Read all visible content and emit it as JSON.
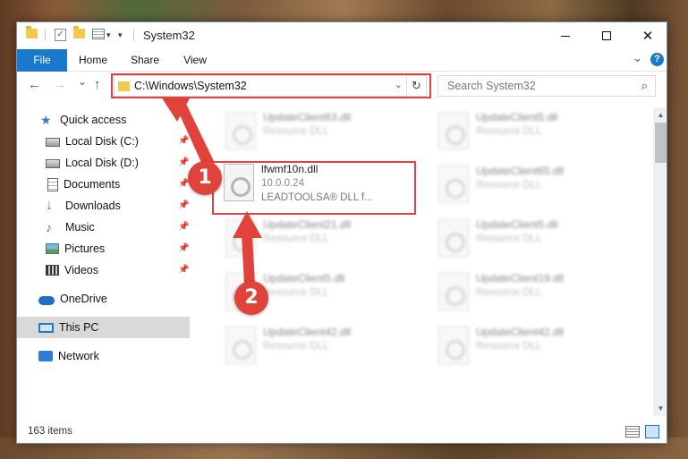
{
  "window": {
    "title": "System32",
    "controls": {
      "minimize": "",
      "maximize": "",
      "close": "✕"
    }
  },
  "ribbon": {
    "tabs": [
      "File",
      "Home",
      "Share",
      "View"
    ],
    "expand_glyph": "⌄",
    "help_glyph": "?"
  },
  "navigation": {
    "back_glyph": "←",
    "forward_glyph": "→",
    "recent_glyph": "⌄",
    "up_glyph": "↑"
  },
  "address": {
    "path": "C:\\Windows\\System32",
    "dropdown_glyph": "⌄",
    "refresh_glyph": "↻"
  },
  "search": {
    "placeholder": "Search System32",
    "icon_glyph": "⌕"
  },
  "sidebar": {
    "items": [
      {
        "label": "Quick access",
        "icon": "star-icon",
        "pinned": false
      },
      {
        "label": "Local Disk (C:)",
        "icon": "drive-icon",
        "pinned": true
      },
      {
        "label": "Local Disk (D:)",
        "icon": "drive-icon",
        "pinned": true
      },
      {
        "label": "Documents",
        "icon": "document-icon",
        "pinned": true
      },
      {
        "label": "Downloads",
        "icon": "download-icon",
        "pinned": true
      },
      {
        "label": "Music",
        "icon": "music-icon",
        "pinned": true
      },
      {
        "label": "Pictures",
        "icon": "pictures-icon",
        "pinned": true
      },
      {
        "label": "Videos",
        "icon": "video-icon",
        "pinned": true
      },
      {
        "label": "OneDrive",
        "icon": "cloud-icon",
        "pinned": false
      },
      {
        "label": "This PC",
        "icon": "computer-icon",
        "pinned": false,
        "selected": true
      },
      {
        "label": "Network",
        "icon": "network-icon",
        "pinned": false
      }
    ],
    "pin_glyph": "📌"
  },
  "files": {
    "left_column": [
      {
        "name": "UpdateClient63.dll",
        "type": "Resource DLL",
        "blurred": true
      },
      {
        "name": "lfwmf10n.dll",
        "version": "10.0.0.24",
        "description": "LEADTOOLSA® DLL f...",
        "blurred": false
      },
      {
        "name": "UpdateClient21.dll",
        "type": "Resource DLL",
        "blurred": true
      },
      {
        "name": "UpdateClient5.dll",
        "type": "Resource DLL",
        "blurred": true
      },
      {
        "name": "UpdateClient42.dll",
        "type": "Resource DLL",
        "blurred": true
      }
    ],
    "right_column": [
      {
        "name": "UpdateClient5.dll",
        "type": "Resource DLL",
        "blurred": true
      },
      {
        "name": "UpdateClient65.dll",
        "type": "Resource DLL",
        "blurred": true
      },
      {
        "name": "UpdateClient5.dll",
        "type": "Resource DLL",
        "blurred": true
      },
      {
        "name": "UpdateClient19.dll",
        "type": "Resource DLL",
        "blurred": true
      },
      {
        "name": "UpdateClient42.dll",
        "type": "Resource DLL",
        "blurred": true
      }
    ]
  },
  "status": {
    "item_count": "163 items"
  },
  "annotations": {
    "step1": "1",
    "step2": "2"
  },
  "colors": {
    "accent": "#1979ca",
    "callout": "#e0433c",
    "selection": "#d9d9d9"
  }
}
